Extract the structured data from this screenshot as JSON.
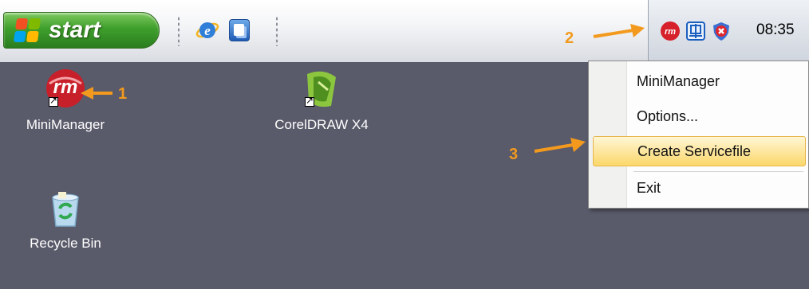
{
  "taskbar": {
    "start_label": "start",
    "quick_launch": [
      {
        "icon": "internet-explorer-icon"
      },
      {
        "icon": "app-window-icon"
      }
    ],
    "tray": {
      "icons": [
        "minimanager-rm-icon",
        "network-icon",
        "security-shield-icon"
      ],
      "clock": "08:35"
    }
  },
  "desktop": {
    "icons": [
      {
        "label": "MiniManager",
        "icon": "minimanager-icon"
      },
      {
        "label": "CorelDRAW X4",
        "icon": "coreldraw-icon"
      },
      {
        "label": "Recycle Bin",
        "icon": "recycle-bin-icon"
      }
    ]
  },
  "context_menu": {
    "items": [
      {
        "label": "MiniManager",
        "highlighted": false
      },
      {
        "label": "Options...",
        "highlighted": false
      },
      {
        "label": "Create Servicefile",
        "highlighted": true
      },
      {
        "label": "Exit",
        "highlighted": false
      }
    ]
  },
  "annotations": {
    "step1": "1",
    "step2": "2",
    "step3": "3",
    "color": "#f39a1e"
  },
  "colors": {
    "desktop_bg": "#595a6a",
    "start_green": "#3f9f2c",
    "menu_highlight": "#fbd86a"
  }
}
